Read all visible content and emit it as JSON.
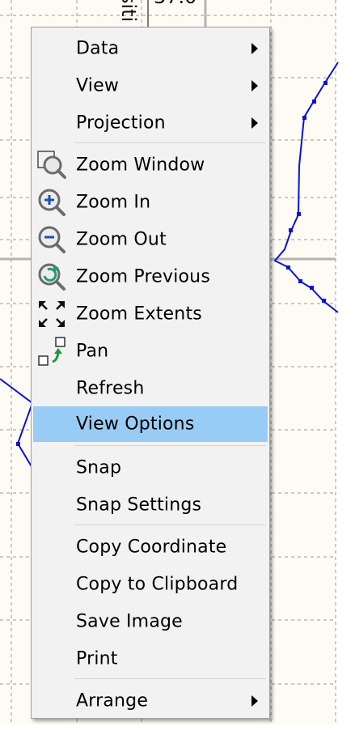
{
  "map": {
    "background": "#fdfbf3",
    "grid_color": "#9a9a9a",
    "axis_color": "#b4b4b4",
    "line_color": "#0a12d6",
    "partial_text_top": "37.0",
    "partial_text_rotated": "siti"
  },
  "menu": {
    "items": [
      {
        "label": "Data",
        "submenu": true
      },
      {
        "label": "View",
        "submenu": true
      },
      {
        "label": "Projection",
        "submenu": true
      },
      {
        "label": "Zoom Window",
        "icon": "zoom-window-icon"
      },
      {
        "label": "Zoom In",
        "icon": "zoom-in-icon"
      },
      {
        "label": "Zoom Out",
        "icon": "zoom-out-icon"
      },
      {
        "label": "Zoom Previous",
        "icon": "zoom-previous-icon"
      },
      {
        "label": "Zoom Extents",
        "icon": "zoom-extents-icon"
      },
      {
        "label": "Pan",
        "icon": "pan-icon"
      },
      {
        "label": "Refresh"
      },
      {
        "label": "View Options",
        "highlighted": true
      },
      {
        "label": "Snap"
      },
      {
        "label": "Snap Settings"
      },
      {
        "label": "Copy Coordinate"
      },
      {
        "label": "Copy to Clipboard"
      },
      {
        "label": "Save Image"
      },
      {
        "label": "Print"
      },
      {
        "label": "Arrange",
        "submenu": true
      }
    ],
    "highlight_color": "#99ccf4",
    "background": "#f2f2f2"
  }
}
